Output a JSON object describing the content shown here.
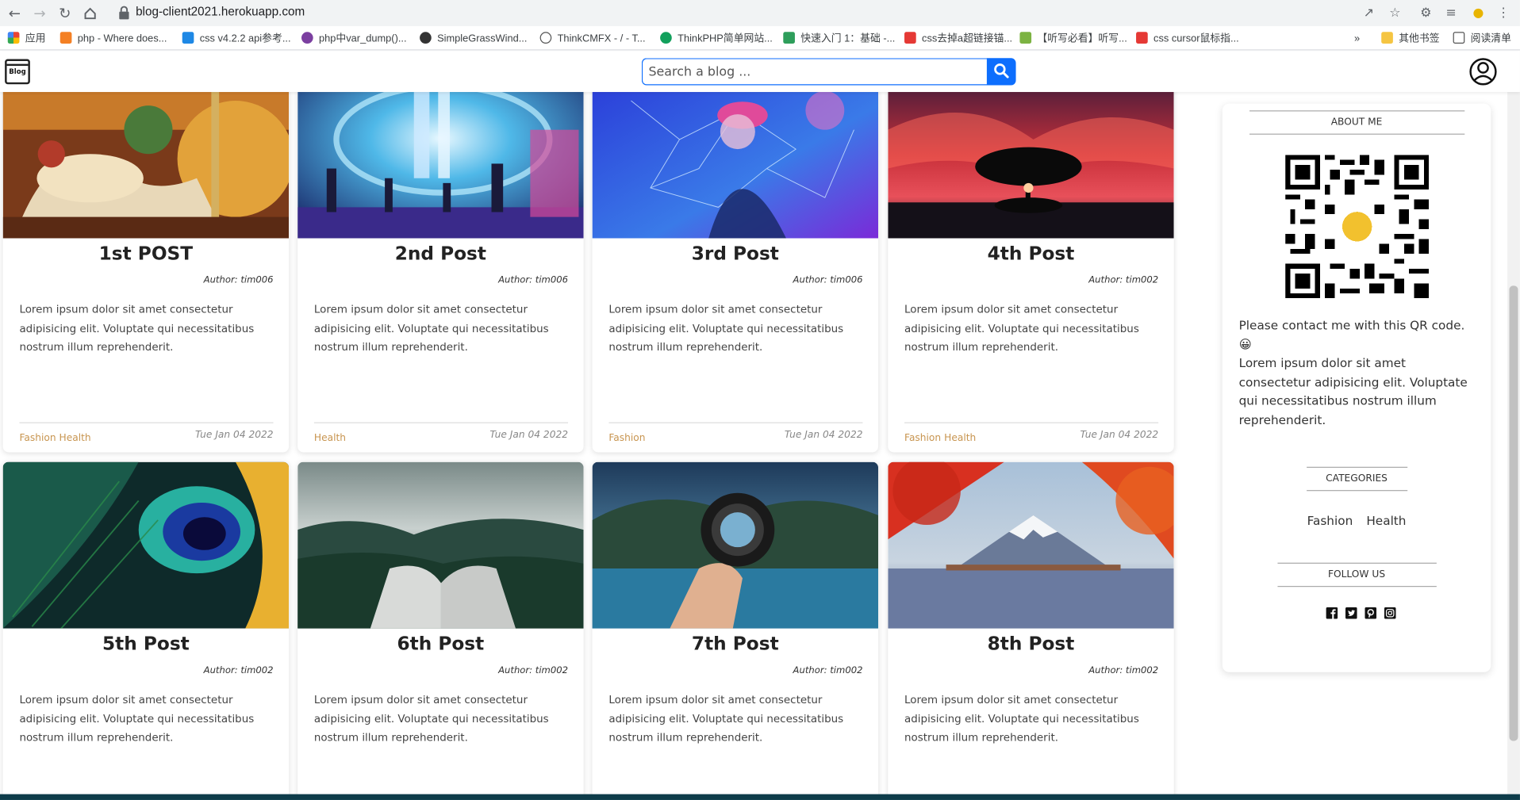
{
  "browser": {
    "url": "blog-client2021.herokuapp.com",
    "bookmarks": [
      {
        "label": "应用",
        "color": "#ea4335"
      },
      {
        "label": "php - Where does...",
        "color": "#f48024"
      },
      {
        "label": "css v4.2.2 api参考...",
        "color": "#1e88e5"
      },
      {
        "label": "php中var_dump()...",
        "color": "#7b3fa0"
      },
      {
        "label": "SimpleGrassWind...",
        "color": "#333333"
      },
      {
        "label": "ThinkCMFX - / - T...",
        "color": "#555555"
      },
      {
        "label": "ThinkPHP简单网站...",
        "color": "#12a05c"
      },
      {
        "label": "快速入门 1：基础 -...",
        "color": "#2e9e5b"
      },
      {
        "label": "css去掉a超链接锚...",
        "color": "#e53935"
      },
      {
        "label": "【听写必看】听写...",
        "color": "#7cb342"
      },
      {
        "label": "css cursor鼠标指...",
        "color": "#e53935"
      }
    ],
    "more": "»",
    "other_bookmarks": "其他书签",
    "reading_list": "阅读清单"
  },
  "navbar": {
    "logo_text": "Blog",
    "search_placeholder": "Search a blog ...",
    "accent_color": "#0d6efd"
  },
  "posts": [
    {
      "title": "1st POST",
      "author": "Author: tim006",
      "body": "Lorem ipsum dolor sit amet consectetur adipisicing elit. Voluptate qui necessitatibus nostrum illum reprehenderit.",
      "categories": [
        "Fashion",
        "Health"
      ],
      "date": "Tue Jan 04 2022"
    },
    {
      "title": "2nd Post",
      "author": "Author: tim006",
      "body": "Lorem ipsum dolor sit amet consectetur adipisicing elit. Voluptate qui necessitatibus nostrum illum reprehenderit.",
      "categories": [
        "Health"
      ],
      "date": "Tue Jan 04 2022"
    },
    {
      "title": "3rd Post",
      "author": "Author: tim006",
      "body": "Lorem ipsum dolor sit amet consectetur adipisicing elit. Voluptate qui necessitatibus nostrum illum reprehenderit.",
      "categories": [
        "Fashion"
      ],
      "date": "Tue Jan 04 2022"
    },
    {
      "title": "4th Post",
      "author": "Author: tim002",
      "body": "Lorem ipsum dolor sit amet consectetur adipisicing elit. Voluptate qui necessitatibus nostrum illum reprehenderit.",
      "categories": [
        "Fashion",
        "Health"
      ],
      "date": "Tue Jan 04 2022"
    },
    {
      "title": "5th Post",
      "author": "Author: tim002",
      "body": "Lorem ipsum dolor sit amet consectetur adipisicing elit. Voluptate qui necessitatibus nostrum illum reprehenderit."
    },
    {
      "title": "6th Post",
      "author": "Author: tim002",
      "body": "Lorem ipsum dolor sit amet consectetur adipisicing elit. Voluptate qui necessitatibus nostrum illum reprehenderit."
    },
    {
      "title": "7th Post",
      "author": "Author: tim002",
      "body": "Lorem ipsum dolor sit amet consectetur adipisicing elit. Voluptate qui necessitatibus nostrum illum reprehenderit."
    },
    {
      "title": "8th Post",
      "author": "Author: tim002",
      "body": "Lorem ipsum dolor sit amet consectetur adipisicing elit. Voluptate qui necessitatibus nostrum illum reprehenderit."
    }
  ],
  "sidebar": {
    "about_title": "ABOUT ME",
    "qr_caption": "Please contact me with this QR code. 😀",
    "about_text": "Lorem ipsum dolor sit amet consectetur adipisicing elit. Voluptate qui necessitatibus nostrum illum reprehenderit.",
    "categories_title": "CATEGORIES",
    "categories": [
      "Fashion",
      "Health"
    ],
    "follow_title": "FOLLOW US",
    "social_icons": [
      "facebook-icon",
      "twitter-icon",
      "pinterest-icon",
      "instagram-icon"
    ]
  }
}
